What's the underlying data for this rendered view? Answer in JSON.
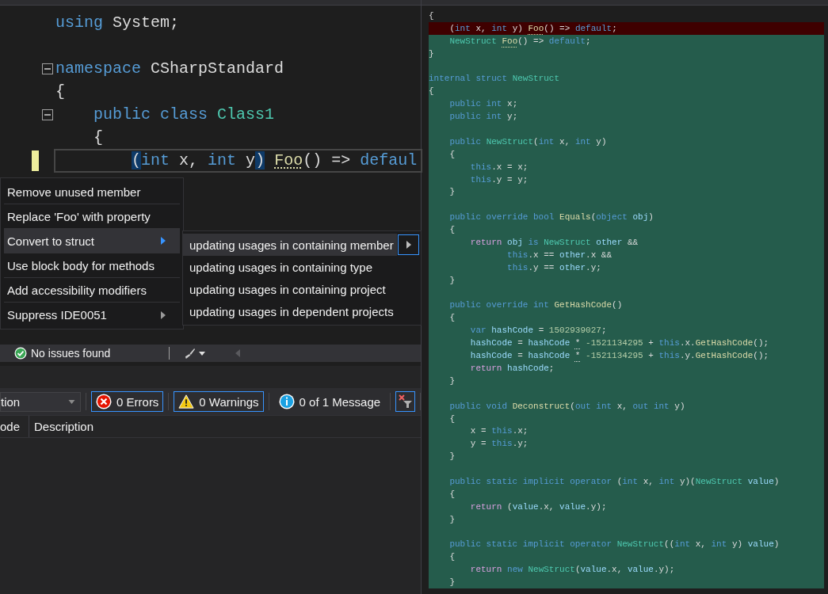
{
  "editor": {
    "lines": [
      {
        "kind": "code",
        "tokens": [
          {
            "kind": "keyword",
            "text": "using"
          },
          {
            "kind": "plain",
            "text": " System;"
          }
        ]
      },
      {
        "kind": "blank"
      },
      {
        "kind": "code",
        "fold": true,
        "tokens": [
          {
            "kind": "keyword",
            "text": "namespace"
          },
          {
            "kind": "plain",
            "text": " CSharpStandard"
          }
        ]
      },
      {
        "kind": "code",
        "tokens": [
          {
            "kind": "plain",
            "text": "{"
          }
        ]
      },
      {
        "kind": "code",
        "fold": true,
        "tokens": [
          {
            "kind": "keyword",
            "text": "    public class"
          },
          {
            "kind": "type",
            "text": " Class1"
          }
        ]
      },
      {
        "kind": "code",
        "tokens": [
          {
            "kind": "plain",
            "text": "    {"
          }
        ]
      },
      {
        "kind": "code",
        "current": true,
        "tokens": [
          {
            "kind": "plain",
            "text": "        (",
            "match": true
          },
          {
            "kind": "keyword",
            "text": "int"
          },
          {
            "kind": "plain",
            "text": " x, "
          },
          {
            "kind": "keyword",
            "text": "int"
          },
          {
            "kind": "plain",
            "text": " y"
          },
          {
            "kind": "plain",
            "text": ")",
            "match": true
          },
          {
            "kind": "method",
            "text": " Foo",
            "hint": true
          },
          {
            "kind": "plain",
            "text": "() => "
          },
          {
            "kind": "keyword",
            "text": "defaul"
          }
        ]
      }
    ]
  },
  "quick_actions": {
    "items": [
      {
        "label": "Remove unused member",
        "selected": false,
        "submenu": false
      },
      {
        "label": "Replace 'Foo' with property",
        "selected": false,
        "submenu": false
      },
      {
        "label": "Convert to struct",
        "selected": true,
        "submenu": true
      },
      {
        "label": "Use block body for methods",
        "selected": false,
        "submenu": false
      },
      {
        "label": "Add accessibility modifiers",
        "selected": false,
        "submenu": false
      },
      {
        "label": "Suppress IDE0051",
        "selected": false,
        "submenu": true
      }
    ],
    "submenu": [
      {
        "label": "updating usages in containing member",
        "selected": true
      },
      {
        "label": "updating usages in containing type",
        "selected": false
      },
      {
        "label": "updating usages in containing project",
        "selected": false
      },
      {
        "label": "updating usages in dependent projects",
        "selected": false
      }
    ]
  },
  "status_bar": {
    "issues": "No issues found"
  },
  "error_list": {
    "scope": "tion",
    "errors": "0 Errors",
    "warnings": "0 Warnings",
    "messages": "0 of 1 Message",
    "columns": [
      "ode",
      "Description"
    ]
  },
  "preview": {
    "lines": [
      {
        "kind": "context",
        "tokens": [
          {
            "kind": "plain",
            "text": "{"
          }
        ]
      },
      {
        "kind": "removed",
        "tokens": [
          {
            "kind": "plain",
            "text": "    ("
          },
          {
            "kind": "keyword",
            "text": "int"
          },
          {
            "kind": "plain",
            "text": " x, "
          },
          {
            "kind": "keyword",
            "text": "int"
          },
          {
            "kind": "plain",
            "text": " y)"
          },
          {
            "kind": "method",
            "text": " Foo",
            "hint": true
          },
          {
            "kind": "plain",
            "text": "() => "
          },
          {
            "kind": "keyword",
            "text": "default"
          },
          {
            "kind": "plain",
            "text": ";"
          }
        ]
      },
      {
        "kind": "added",
        "tokens": [
          {
            "kind": "type",
            "text": "    NewStruct"
          },
          {
            "kind": "method",
            "text": " Foo",
            "hint": true
          },
          {
            "kind": "plain",
            "text": "() => "
          },
          {
            "kind": "keyword",
            "text": "default"
          },
          {
            "kind": "plain",
            "text": ";"
          }
        ]
      },
      {
        "kind": "added",
        "tokens": [
          {
            "kind": "plain",
            "text": "}"
          }
        ]
      },
      {
        "kind": "added"
      },
      {
        "kind": "added",
        "tokens": [
          {
            "kind": "keyword",
            "text": "internal struct"
          },
          {
            "kind": "type",
            "text": " NewStruct"
          }
        ]
      },
      {
        "kind": "added",
        "tokens": [
          {
            "kind": "plain",
            "text": "{"
          }
        ]
      },
      {
        "kind": "added",
        "tokens": [
          {
            "kind": "keyword",
            "text": "    public int"
          },
          {
            "kind": "plain",
            "text": " x;"
          }
        ]
      },
      {
        "kind": "added",
        "tokens": [
          {
            "kind": "keyword",
            "text": "    public int"
          },
          {
            "kind": "plain",
            "text": " y;"
          }
        ]
      },
      {
        "kind": "added"
      },
      {
        "kind": "added",
        "tokens": [
          {
            "kind": "keyword",
            "text": "    public"
          },
          {
            "kind": "type",
            "text": " NewStruct"
          },
          {
            "kind": "plain",
            "text": "("
          },
          {
            "kind": "keyword",
            "text": "int"
          },
          {
            "kind": "plain",
            "text": " x, "
          },
          {
            "kind": "keyword",
            "text": "int"
          },
          {
            "kind": "plain",
            "text": " y)"
          }
        ]
      },
      {
        "kind": "added",
        "tokens": [
          {
            "kind": "plain",
            "text": "    {"
          }
        ]
      },
      {
        "kind": "added",
        "tokens": [
          {
            "kind": "keyword",
            "text": "        this"
          },
          {
            "kind": "plain",
            "text": ".x = x;"
          }
        ]
      },
      {
        "kind": "added",
        "tokens": [
          {
            "kind": "keyword",
            "text": "        this"
          },
          {
            "kind": "plain",
            "text": ".y = y;"
          }
        ]
      },
      {
        "kind": "added",
        "tokens": [
          {
            "kind": "plain",
            "text": "    }"
          }
        ]
      },
      {
        "kind": "added"
      },
      {
        "kind": "added",
        "tokens": [
          {
            "kind": "keyword",
            "text": "    public override bool"
          },
          {
            "kind": "method",
            "text": " Equals"
          },
          {
            "kind": "plain",
            "text": "("
          },
          {
            "kind": "keyword",
            "text": "object"
          },
          {
            "kind": "local",
            "text": " obj"
          },
          {
            "kind": "plain",
            "text": ")"
          }
        ]
      },
      {
        "kind": "added",
        "tokens": [
          {
            "kind": "plain",
            "text": "    {"
          }
        ]
      },
      {
        "kind": "added",
        "tokens": [
          {
            "kind": "control",
            "text": "        return"
          },
          {
            "kind": "local",
            "text": " obj"
          },
          {
            "kind": "keyword",
            "text": " is"
          },
          {
            "kind": "type",
            "text": " NewStruct"
          },
          {
            "kind": "local",
            "text": " other"
          },
          {
            "kind": "plain",
            "text": " &&"
          }
        ]
      },
      {
        "kind": "added",
        "tokens": [
          {
            "kind": "keyword",
            "text": "               this"
          },
          {
            "kind": "plain",
            "text": ".x == "
          },
          {
            "kind": "local",
            "text": "other"
          },
          {
            "kind": "plain",
            "text": ".x &&"
          }
        ]
      },
      {
        "kind": "added",
        "tokens": [
          {
            "kind": "keyword",
            "text": "               this"
          },
          {
            "kind": "plain",
            "text": ".y == "
          },
          {
            "kind": "local",
            "text": "other"
          },
          {
            "kind": "plain",
            "text": ".y;"
          }
        ]
      },
      {
        "kind": "added",
        "tokens": [
          {
            "kind": "plain",
            "text": "    }"
          }
        ]
      },
      {
        "kind": "added"
      },
      {
        "kind": "added",
        "tokens": [
          {
            "kind": "keyword",
            "text": "    public override int"
          },
          {
            "kind": "method",
            "text": " GetHashCode"
          },
          {
            "kind": "plain",
            "text": "()"
          }
        ]
      },
      {
        "kind": "added",
        "tokens": [
          {
            "kind": "plain",
            "text": "    {"
          }
        ]
      },
      {
        "kind": "added",
        "tokens": [
          {
            "kind": "keyword",
            "text": "        var"
          },
          {
            "kind": "local",
            "text": " hashCode"
          },
          {
            "kind": "plain",
            "text": " = "
          },
          {
            "kind": "number",
            "text": "1502939027"
          },
          {
            "kind": "plain",
            "text": ";"
          }
        ]
      },
      {
        "kind": "added",
        "tokens": [
          {
            "kind": "local",
            "text": "        hashCode"
          },
          {
            "kind": "plain",
            "text": " = "
          },
          {
            "kind": "local",
            "text": "hashCode"
          },
          {
            "kind": "plain",
            "text": " *",
            "hint": true
          },
          {
            "kind": "number",
            "text": " -1521134295"
          },
          {
            "kind": "plain",
            "text": " + "
          },
          {
            "kind": "keyword",
            "text": "this"
          },
          {
            "kind": "plain",
            "text": ".x."
          },
          {
            "kind": "method",
            "text": "GetHashCode"
          },
          {
            "kind": "plain",
            "text": "();"
          }
        ]
      },
      {
        "kind": "added",
        "tokens": [
          {
            "kind": "local",
            "text": "        hashCode"
          },
          {
            "kind": "plain",
            "text": " = "
          },
          {
            "kind": "local",
            "text": "hashCode"
          },
          {
            "kind": "plain",
            "text": " *",
            "hint": true
          },
          {
            "kind": "number",
            "text": " -1521134295"
          },
          {
            "kind": "plain",
            "text": " + "
          },
          {
            "kind": "keyword",
            "text": "this"
          },
          {
            "kind": "plain",
            "text": ".y."
          },
          {
            "kind": "method",
            "text": "GetHashCode"
          },
          {
            "kind": "plain",
            "text": "();"
          }
        ]
      },
      {
        "kind": "added",
        "tokens": [
          {
            "kind": "control",
            "text": "        return"
          },
          {
            "kind": "local",
            "text": " hashCode"
          },
          {
            "kind": "plain",
            "text": ";"
          }
        ]
      },
      {
        "kind": "added",
        "tokens": [
          {
            "kind": "plain",
            "text": "    }"
          }
        ]
      },
      {
        "kind": "added"
      },
      {
        "kind": "added",
        "tokens": [
          {
            "kind": "keyword",
            "text": "    public void"
          },
          {
            "kind": "method",
            "text": " Deconstruct"
          },
          {
            "kind": "plain",
            "text": "("
          },
          {
            "kind": "keyword",
            "text": "out int"
          },
          {
            "kind": "plain",
            "text": " x, "
          },
          {
            "kind": "keyword",
            "text": "out int"
          },
          {
            "kind": "plain",
            "text": " y)"
          }
        ]
      },
      {
        "kind": "added",
        "tokens": [
          {
            "kind": "plain",
            "text": "    {"
          }
        ]
      },
      {
        "kind": "added",
        "tokens": [
          {
            "kind": "plain",
            "text": "        x = "
          },
          {
            "kind": "keyword",
            "text": "this"
          },
          {
            "kind": "plain",
            "text": ".x;"
          }
        ]
      },
      {
        "kind": "added",
        "tokens": [
          {
            "kind": "plain",
            "text": "        y = "
          },
          {
            "kind": "keyword",
            "text": "this"
          },
          {
            "kind": "plain",
            "text": ".y;"
          }
        ]
      },
      {
        "kind": "added",
        "tokens": [
          {
            "kind": "plain",
            "text": "    }"
          }
        ]
      },
      {
        "kind": "added"
      },
      {
        "kind": "added",
        "tokens": [
          {
            "kind": "keyword",
            "text": "    public static implicit operator"
          },
          {
            "kind": "plain",
            "text": " ("
          },
          {
            "kind": "keyword",
            "text": "int"
          },
          {
            "kind": "plain",
            "text": " x, "
          },
          {
            "kind": "keyword",
            "text": "int"
          },
          {
            "kind": "plain",
            "text": " y)("
          },
          {
            "kind": "type",
            "text": "NewStruct"
          },
          {
            "kind": "local",
            "text": " value"
          },
          {
            "kind": "plain",
            "text": ")"
          }
        ]
      },
      {
        "kind": "added",
        "tokens": [
          {
            "kind": "plain",
            "text": "    {"
          }
        ]
      },
      {
        "kind": "added",
        "tokens": [
          {
            "kind": "control",
            "text": "        return"
          },
          {
            "kind": "plain",
            "text": " ("
          },
          {
            "kind": "local",
            "text": "value"
          },
          {
            "kind": "plain",
            "text": ".x, "
          },
          {
            "kind": "local",
            "text": "value"
          },
          {
            "kind": "plain",
            "text": ".y);"
          }
        ]
      },
      {
        "kind": "added",
        "tokens": [
          {
            "kind": "plain",
            "text": "    }"
          }
        ]
      },
      {
        "kind": "added"
      },
      {
        "kind": "added",
        "tokens": [
          {
            "kind": "keyword",
            "text": "    public static implicit operator"
          },
          {
            "kind": "type",
            "text": " NewStruct"
          },
          {
            "kind": "plain",
            "text": "(("
          },
          {
            "kind": "keyword",
            "text": "int"
          },
          {
            "kind": "plain",
            "text": " x, "
          },
          {
            "kind": "keyword",
            "text": "int"
          },
          {
            "kind": "plain",
            "text": " y) "
          },
          {
            "kind": "local",
            "text": "value"
          },
          {
            "kind": "plain",
            "text": ")"
          }
        ]
      },
      {
        "kind": "added",
        "tokens": [
          {
            "kind": "plain",
            "text": "    {"
          }
        ]
      },
      {
        "kind": "added",
        "tokens": [
          {
            "kind": "control",
            "text": "        return"
          },
          {
            "kind": "keyword",
            "text": " new"
          },
          {
            "kind": "type",
            "text": " NewStruct"
          },
          {
            "kind": "plain",
            "text": "("
          },
          {
            "kind": "local",
            "text": "value"
          },
          {
            "kind": "plain",
            "text": ".x, "
          },
          {
            "kind": "local",
            "text": "value"
          },
          {
            "kind": "plain",
            "text": ".y);"
          }
        ]
      },
      {
        "kind": "added",
        "tokens": [
          {
            "kind": "plain",
            "text": "    }"
          }
        ]
      }
    ]
  }
}
